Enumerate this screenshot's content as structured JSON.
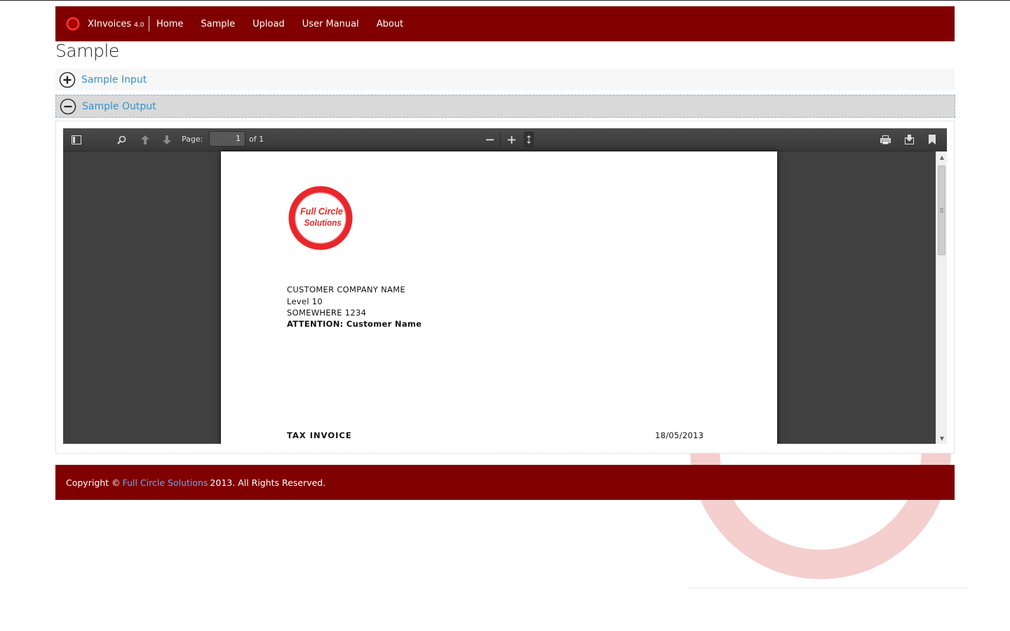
{
  "navbar": {
    "brand_name": "XInvoices",
    "brand_version": "4.0",
    "items": [
      {
        "label": "Home"
      },
      {
        "label": "Sample"
      },
      {
        "label": "Upload"
      },
      {
        "label": "User Manual"
      },
      {
        "label": "About"
      }
    ]
  },
  "page": {
    "title": "Sample"
  },
  "accordion": {
    "items": [
      {
        "label": "Sample Input",
        "state": "collapsed",
        "icon": "plus-circle-icon"
      },
      {
        "label": "Sample Output",
        "state": "expanded",
        "icon": "minus-circle-icon"
      }
    ]
  },
  "pdf_viewer": {
    "page_label": "Page:",
    "current_page": "1",
    "page_count_label": "of 1",
    "zoom_label": "",
    "document": {
      "logo_text_line1": "Full Circle",
      "logo_text_line2": "Solutions",
      "address_lines": [
        "CUSTOMER COMPANY NAME",
        "Level 10",
        "SOMEWHERE 1234"
      ],
      "attention": "ATTENTION: Customer Name",
      "doc_type": "TAX INVOICE",
      "date": "18/05/2013"
    }
  },
  "footer": {
    "prefix": "Copyright ©",
    "link_text": "Full Circle Solutions",
    "suffix": "2013. All Rights Reserved."
  },
  "colors": {
    "brand": "#800000",
    "link": "#3a8fc9",
    "viewer_bg": "#404040"
  }
}
